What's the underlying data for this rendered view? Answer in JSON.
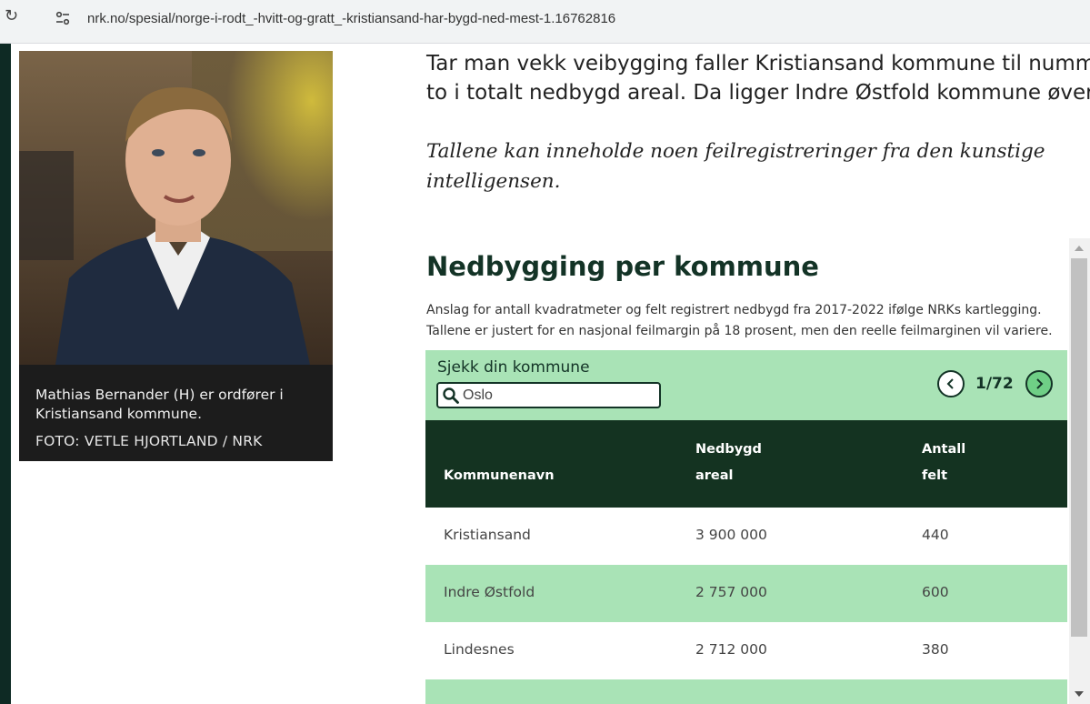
{
  "browser": {
    "url": "nrk.no/spesial/norge-i-rodt_-hvitt-og-gratt_-kristiansand-har-bygd-ned-mest-1.16762816"
  },
  "photo": {
    "caption": "Mathias Bernander (H) er ordfører i Kristiansand kommune.",
    "credit": "FOTO: VETLE HJORTLAND / NRK"
  },
  "article": {
    "para1_line1": "Tar man vekk veibygging faller Kristiansand kommune til nummer",
    "para1_line2": "to i totalt nedbygd areal. Da ligger Indre Østfold kommune øverst.",
    "para2_line1": "Tallene kan inneholde noen feilregistreringer fra den kunstige",
    "para2_line2": "intelligensen."
  },
  "widget": {
    "title": "Nedbygging per kommune",
    "subtitle_line1": "Anslag for antall kvadratmeter og felt registrert nedbygd fra 2017-2022 ifølge NRKs kartlegging.",
    "subtitle_line2": "Tallene er justert for en nasjonal feilmargin på 18 prosent, men den reelle feilmarginen vil variere.",
    "search_label": "Sjekk din kommune",
    "search_placeholder": "Oslo",
    "pager": "1/72",
    "columns": {
      "name": "Kommunenavn",
      "area_1": "Nedbygd",
      "area_2": "areal",
      "fields_1": "Antall",
      "fields_2": "felt"
    },
    "rows": [
      {
        "name": "Kristiansand",
        "area": "3 900 000",
        "fields": "440"
      },
      {
        "name": "Indre Østfold",
        "area": "2 757 000",
        "fields": "600"
      },
      {
        "name": "Lindesnes",
        "area": "2 712 000",
        "fields": "380"
      }
    ]
  },
  "colors": {
    "accent_green": "#a9e3b6",
    "header_dark": "#143321"
  }
}
